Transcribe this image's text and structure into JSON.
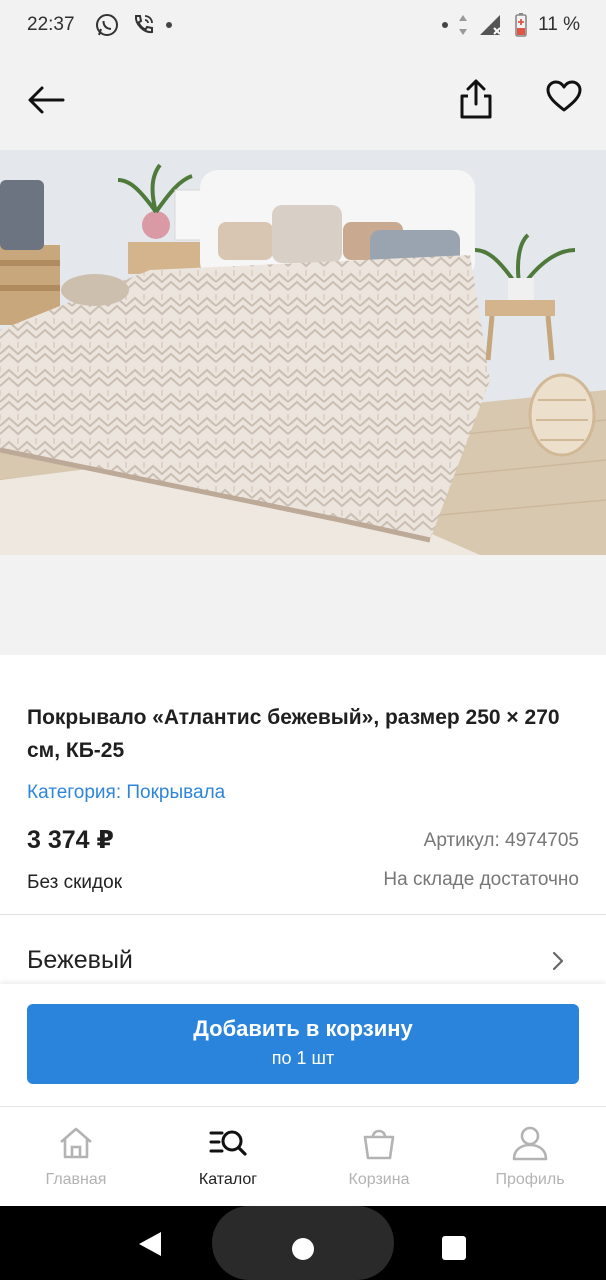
{
  "status_bar": {
    "time": "22:37",
    "battery": "11 %",
    "left_icons": [
      "whatsapp-icon",
      "phone-icon",
      "dot-icon"
    ],
    "right_icons": [
      "dot-icon",
      "data-arrows-icon",
      "signal-icon",
      "battery-icon"
    ]
  },
  "header": {
    "back_icon": "arrow-left-icon",
    "share_icon": "share-icon",
    "favorite_icon": "heart-icon"
  },
  "product": {
    "title": "Покрывало «Атлантис бежевый», размер 250 × 270 см, КБ-25",
    "category": "Категория: Покрывала",
    "price": "3 374 ₽",
    "article": "Артикул: 4974705",
    "discount": "Без скидок",
    "stock": "На складе достаточно"
  },
  "variant": {
    "color": "Бежевый"
  },
  "cart_button": {
    "label": "Добавить в корзину",
    "sublabel": "по 1 шт"
  },
  "tabs": [
    {
      "label": "Главная",
      "icon": "home-icon",
      "active": false
    },
    {
      "label": "Каталог",
      "icon": "catalog-search-icon",
      "active": true
    },
    {
      "label": "Корзина",
      "icon": "bag-icon",
      "active": false
    },
    {
      "label": "Профиль",
      "icon": "profile-icon",
      "active": false
    }
  ],
  "colors": {
    "accent": "#2b84db",
    "link": "#2e86d9",
    "header_bg": "#f2f2f2"
  }
}
